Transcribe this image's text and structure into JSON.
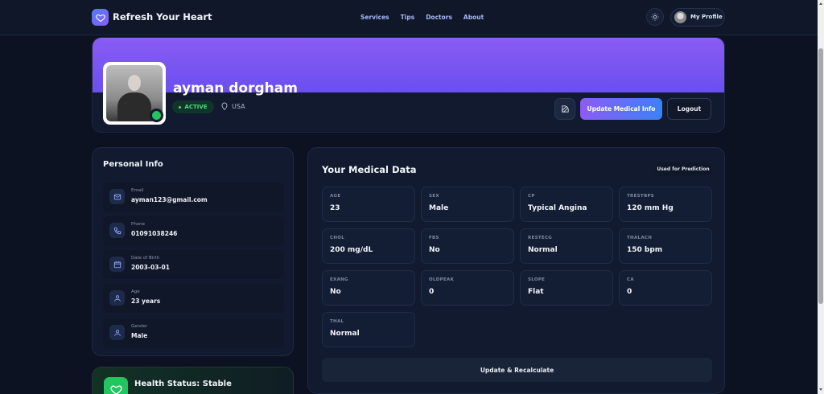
{
  "nav": {
    "brand": "Refresh Your Heart",
    "links": [
      "Services",
      "Tips",
      "Doctors",
      "About"
    ],
    "profile_label": "My Profile",
    "icons": {
      "logo": "heart-icon",
      "theme": "sun-icon"
    }
  },
  "profile": {
    "name": "ayman dorgham",
    "status": "ACTIVE",
    "location": "USA",
    "update_label": "Update Medical Info",
    "logout_label": "Logout"
  },
  "personal_info": {
    "title": "Personal Info",
    "items": [
      {
        "label": "Email",
        "value": "ayman123@gmail.com",
        "icon": "mail-icon"
      },
      {
        "label": "Phone",
        "value": "01091038246",
        "icon": "phone-icon"
      },
      {
        "label": "Date of Birth",
        "value": "2003-03-01",
        "icon": "calendar-icon"
      },
      {
        "label": "Age",
        "value": "23 years",
        "icon": "user-icon"
      },
      {
        "label": "Gender",
        "value": "Male",
        "icon": "user-icon"
      }
    ]
  },
  "health_status": {
    "title": "Health Status: Stable",
    "icon": "heart-icon"
  },
  "medical": {
    "title": "Your Medical Data",
    "badge": "Used for Prediction",
    "fields": [
      {
        "label": "AGE",
        "value": "23"
      },
      {
        "label": "SEX",
        "value": "Male"
      },
      {
        "label": "CP",
        "value": "Typical Angina"
      },
      {
        "label": "TRESTBPS",
        "value": "120 mm Hg"
      },
      {
        "label": "CHOL",
        "value": "200 mg/dL"
      },
      {
        "label": "FBS",
        "value": "No"
      },
      {
        "label": "RESTECG",
        "value": "Normal"
      },
      {
        "label": "THALACH",
        "value": "150 bpm"
      },
      {
        "label": "EXANG",
        "value": "No"
      },
      {
        "label": "OLDPEAK",
        "value": "0"
      },
      {
        "label": "SLOPE",
        "value": "Flat"
      },
      {
        "label": "CA",
        "value": "0"
      },
      {
        "label": "THAL",
        "value": "Normal"
      }
    ],
    "recalc_label": "Update & Recalculate"
  },
  "colors": {
    "background": "#0c1222",
    "card": "#111a2e",
    "banner_start": "#8a5cf2",
    "banner_end": "#6a4ff0",
    "accent_green": "#22c55e",
    "accent_link": "#a9b7f5"
  }
}
